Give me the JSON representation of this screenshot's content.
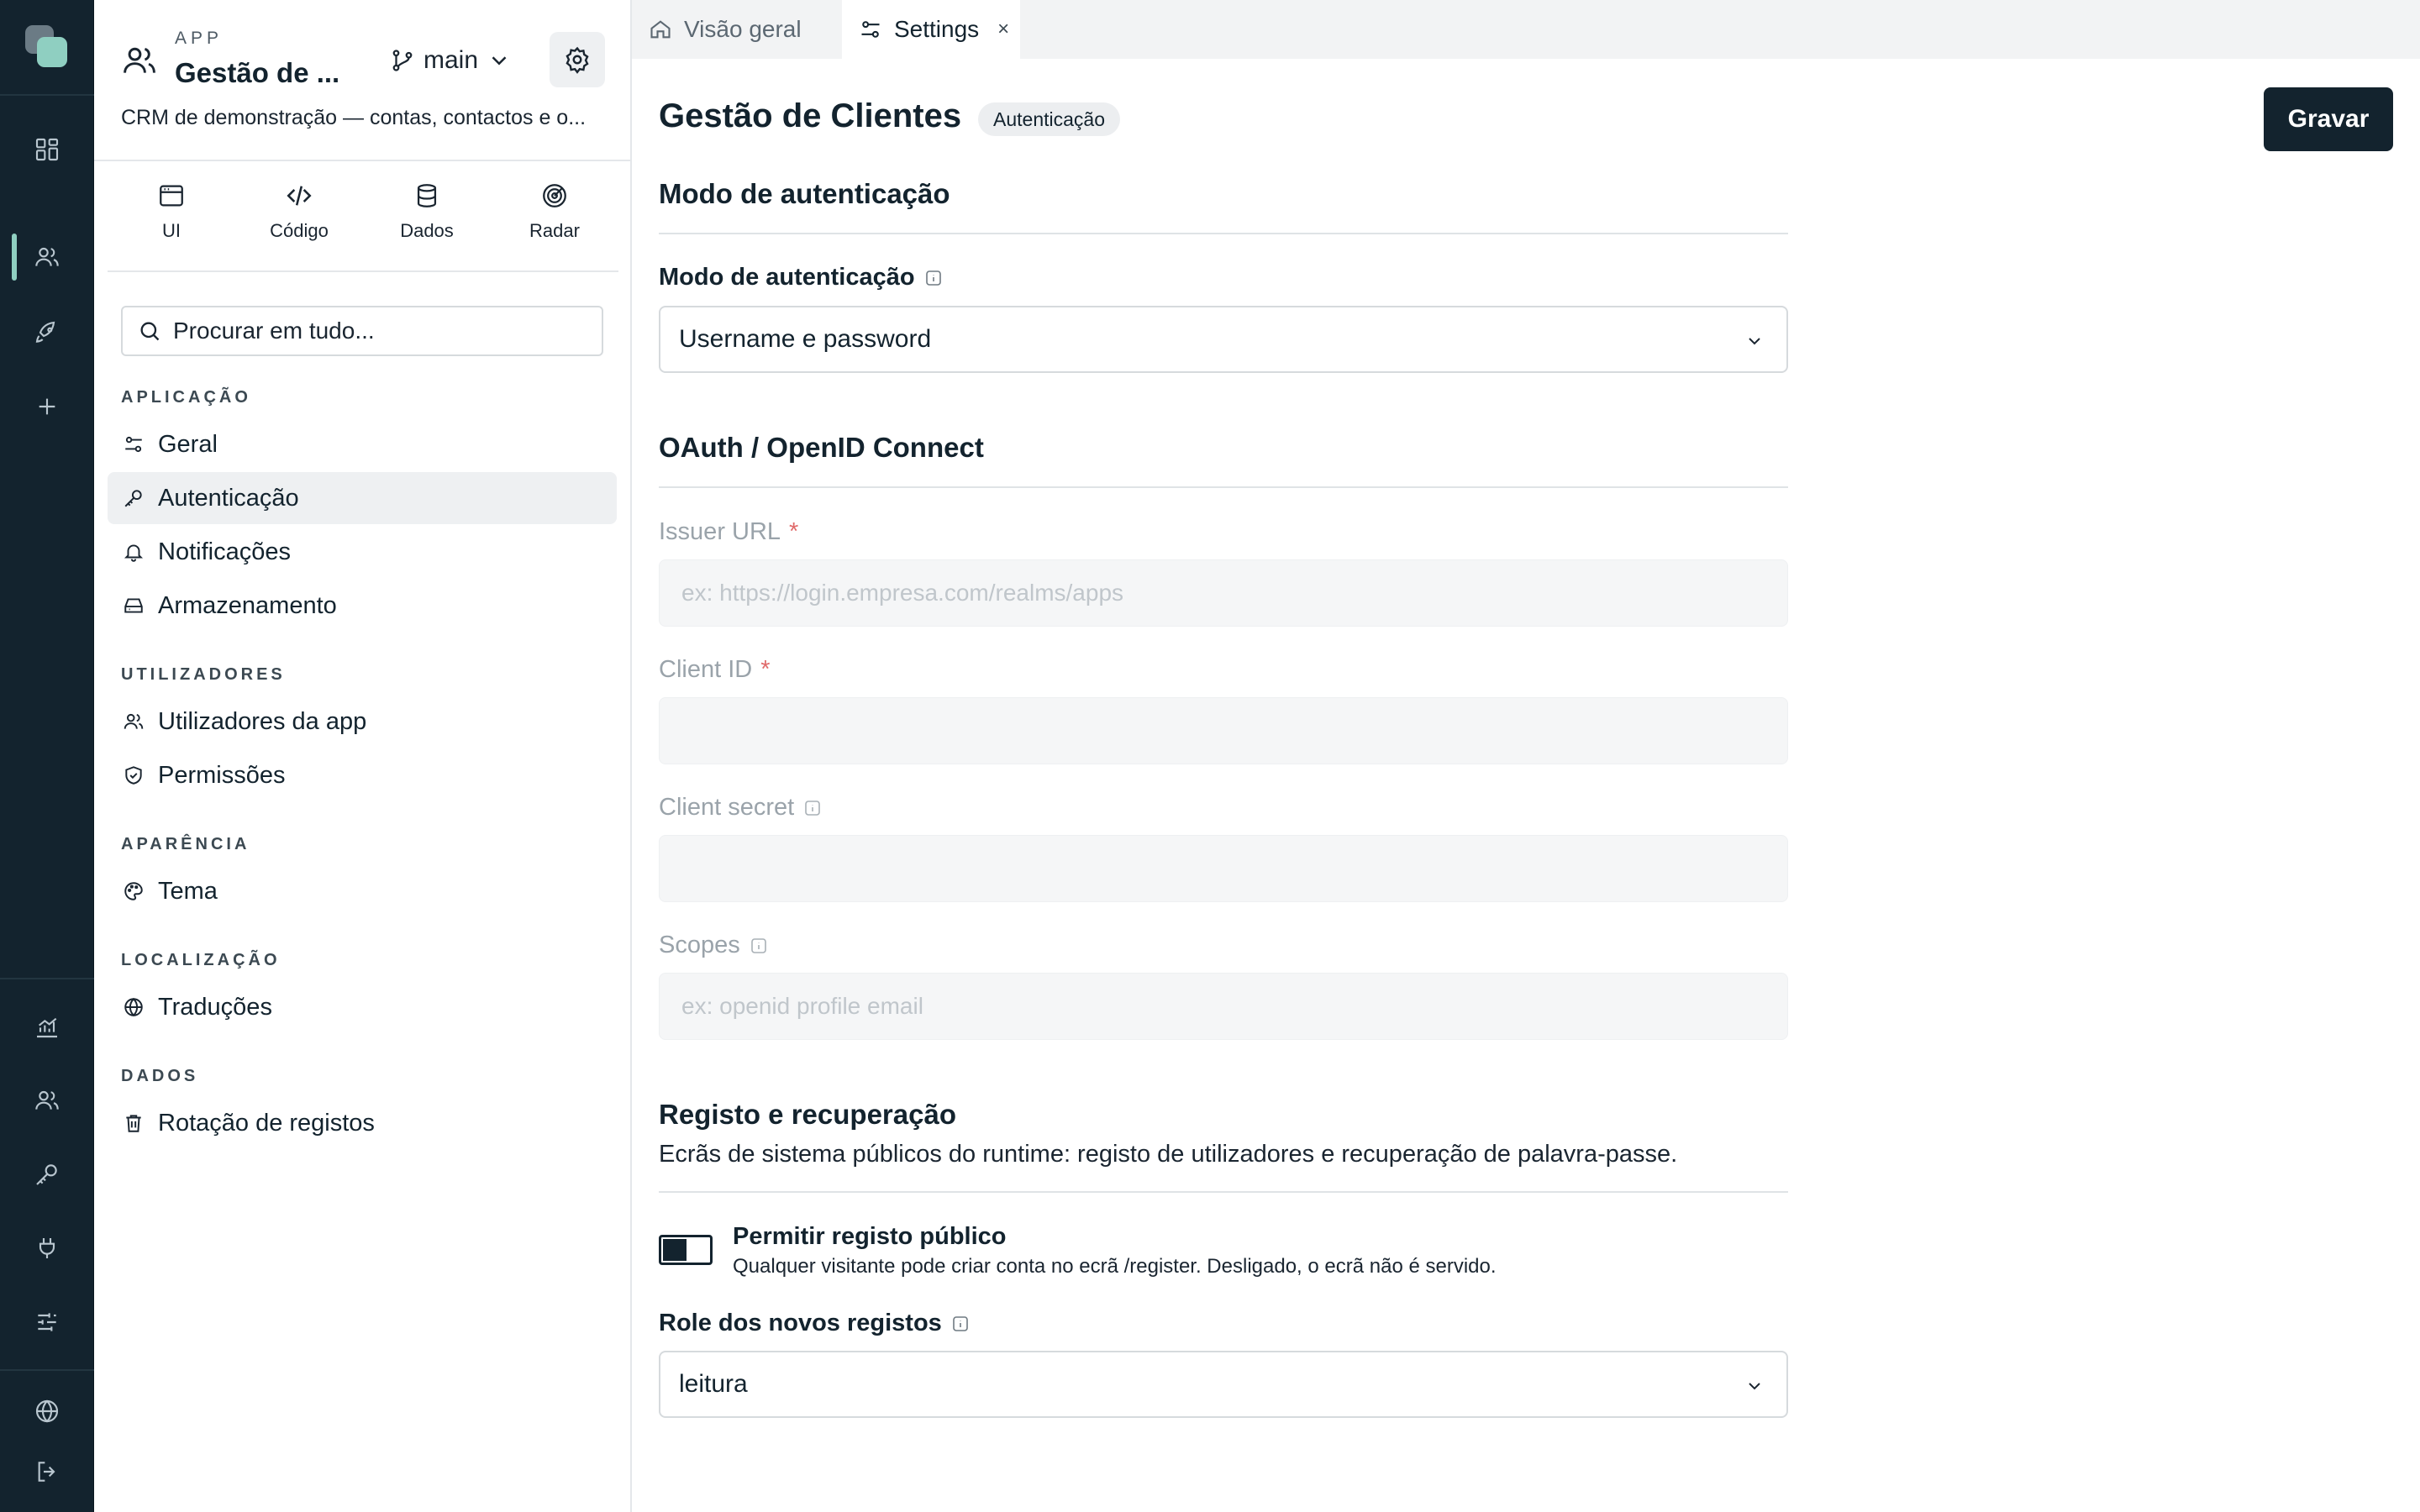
{
  "rail": {
    "icons": [
      "dashboard-icon",
      "users-icon",
      "rocket-icon",
      "plus-icon",
      "chart-icon",
      "users-icon",
      "key-icon",
      "plug-icon",
      "sliders-icon",
      "globe-icon",
      "logout-icon"
    ]
  },
  "app": {
    "kicker": "APP",
    "name": "Gestão de ...",
    "branch": "main",
    "description": "CRM de demonstração — contas, contactos e o..."
  },
  "modes": [
    {
      "label": "UI",
      "icon": "window-icon"
    },
    {
      "label": "Código",
      "icon": "code-icon"
    },
    {
      "label": "Dados",
      "icon": "database-icon"
    },
    {
      "label": "Radar",
      "icon": "radar-icon"
    }
  ],
  "search": {
    "placeholder": "Procurar em tudo..."
  },
  "nav": {
    "groups": {
      "aplicacao": "APLICAÇÃO",
      "utilizadores": "UTILIZADORES",
      "aparencia": "APARÊNCIA",
      "localizacao": "LOCALIZAÇÃO",
      "dados": "DADOS"
    },
    "items": {
      "geral": "Geral",
      "autenticacao": "Autenticação",
      "notificacoes": "Notificações",
      "armazenamento": "Armazenamento",
      "utilizadores_app": "Utilizadores da app",
      "permissoes": "Permissões",
      "tema": "Tema",
      "traducoes": "Traduções",
      "rotacao": "Rotação de registos"
    },
    "active": "autenticacao"
  },
  "tabs": [
    {
      "label": "Visão geral",
      "active": false
    },
    {
      "label": "Settings",
      "active": true,
      "close": "×"
    }
  ],
  "page": {
    "title": "Gestão de Clientes",
    "badge": "Autenticação",
    "save_label": "Gravar"
  },
  "auth_section": {
    "title": "Modo de autenticação",
    "field_label": "Modo de autenticação",
    "selected": "Username e password"
  },
  "oauth_section": {
    "title": "OAuth / OpenID Connect",
    "issuer_label": "Issuer URL",
    "issuer_placeholder": "ex: https://login.empresa.com/realms/apps",
    "client_id_label": "Client ID",
    "client_secret_label": "Client secret",
    "scopes_label": "Scopes",
    "scopes_placeholder": "ex: openid profile email",
    "required_mark": "*"
  },
  "registration_section": {
    "title": "Registo e recuperação",
    "description": "Ecrãs de sistema públicos do runtime: registo de utilizadores e recuperação de palavra-passe.",
    "toggle_label": "Permitir registo público",
    "toggle_help": "Qualquer visitante pode criar conta no ecrã /register. Desligado, o ecrã não é servido.",
    "role_label": "Role dos novos registos",
    "role_selected": "leitura"
  },
  "colors": {
    "rail_bg": "#13232e",
    "accent": "#8fcfc1",
    "primary_button": "#13232e",
    "required": "#e06a6a"
  }
}
